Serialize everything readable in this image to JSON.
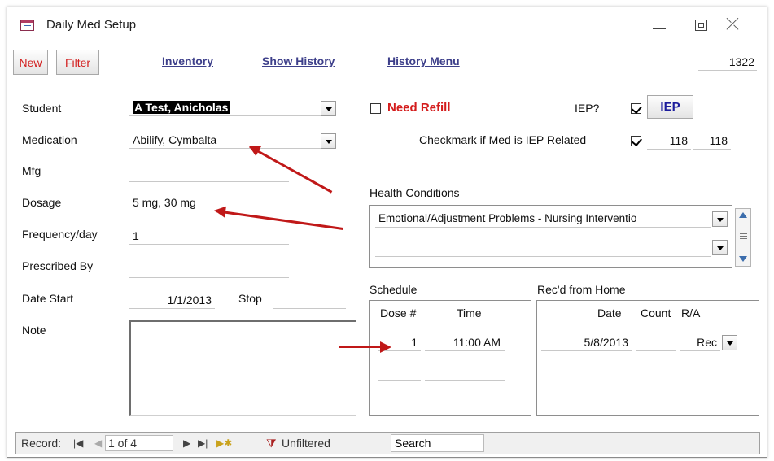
{
  "window": {
    "title": "Daily Med Setup",
    "icon": "form-icon"
  },
  "toolbar": {
    "new_label": "New",
    "filter_label": "Filter",
    "links": [
      "Inventory",
      "Show History",
      "History Menu"
    ],
    "record_id": "1322"
  },
  "form": {
    "student_label": "Student",
    "student_value": "A Test, Anicholas",
    "medication_label": "Medication",
    "medication_value": "Abilify, Cymbalta",
    "mfg_label": "Mfg",
    "mfg_value": "",
    "dosage_label": "Dosage",
    "dosage_value": "5 mg, 30 mg",
    "frequency_label": "Frequency/day",
    "frequency_value": "1",
    "prescribed_label": "Prescribed By",
    "prescribed_value": "",
    "datestart_label": "Date Start",
    "datestart_value": "1/1/2013",
    "stop_label": "Stop",
    "stop_value": "",
    "note_label": "Note"
  },
  "right": {
    "need_refill_label": "Need Refill",
    "need_refill_checked": false,
    "iep_label": "IEP?",
    "iep_checked": true,
    "iep_button": "IEP",
    "iep_related_label": "Checkmark if Med is IEP Related",
    "iep_related_checked": true,
    "num1": "118",
    "num2": "118",
    "health_label": "Health Conditions",
    "health_value": "Emotional/Adjustment Problems - Nursing Interventio",
    "health_value2": ""
  },
  "schedule": {
    "label": "Schedule",
    "col_dose": "Dose #",
    "col_time": "Time",
    "rows": [
      {
        "dose": "1",
        "time": "11:00 AM"
      }
    ]
  },
  "recd": {
    "label": "Rec'd from Home",
    "col_date": "Date",
    "col_count": "Count",
    "col_ra": "R/A",
    "rows": [
      {
        "date": "5/8/2013",
        "count": "",
        "ra": "Rec"
      }
    ]
  },
  "status": {
    "record_label": "Record:",
    "position": "1 of 4",
    "filter": "Unfiltered",
    "search": "Search"
  }
}
